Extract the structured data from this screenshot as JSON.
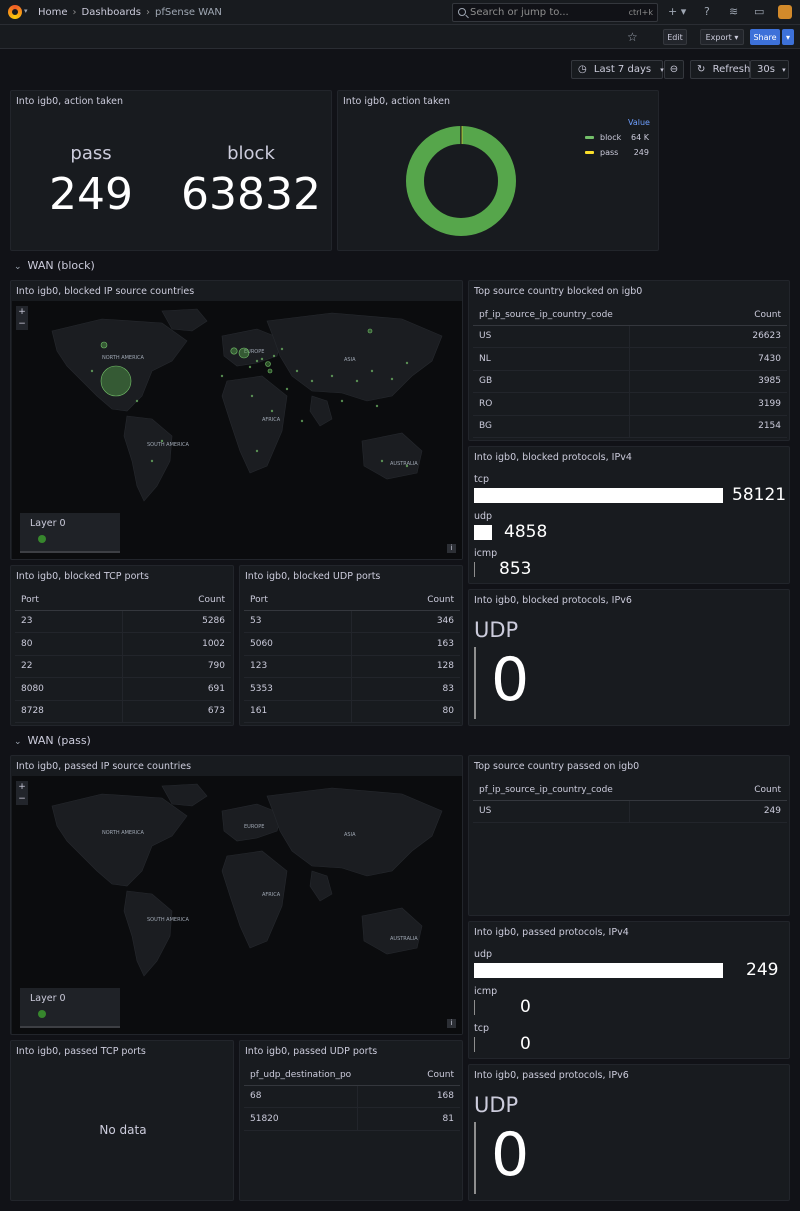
{
  "nav": {
    "breadcrumb": [
      "Home",
      "Dashboards",
      "pfSense WAN"
    ],
    "search_placeholder": "Search or jump to...",
    "search_shortcut": "ctrl+k",
    "icons": [
      "plus-icon",
      "help-icon",
      "rss-icon",
      "monitor-icon"
    ]
  },
  "toolbar": {
    "edit_label": "Edit",
    "export_label": "Export",
    "share_label": "Share"
  },
  "time": {
    "range_label": "Last 7 days",
    "refresh_label": "Refresh",
    "interval_label": "30s"
  },
  "colors": {
    "accent": "#3d71d9",
    "green": "#73bf69",
    "yellow": "#fade2a",
    "panel": "#181b1f",
    "background": "#111217"
  },
  "panels": {
    "action_stat": {
      "title": "Into igb0, action taken",
      "pass_label": "pass",
      "pass_value": "249",
      "block_label": "block",
      "block_value": "63832"
    },
    "action_pie": {
      "title": "Into igb0, action taken",
      "legend_header": "Value",
      "legend": [
        {
          "name": "block",
          "value": "64 K"
        },
        {
          "name": "pass",
          "value": "249"
        }
      ]
    },
    "row_block": {
      "title": "WAN (block)"
    },
    "blocked_map": {
      "title": "Into igb0, blocked IP source countries",
      "layer_label": "Layer 0",
      "info": "i"
    },
    "blocked_country": {
      "title": "Top source country blocked on igb0",
      "col1": "pf_ip_source_ip_country_code",
      "col2": "Count",
      "rows": [
        [
          "US",
          "26623"
        ],
        [
          "NL",
          "7430"
        ],
        [
          "GB",
          "3985"
        ],
        [
          "RO",
          "3199"
        ],
        [
          "BG",
          "2154"
        ]
      ]
    },
    "blocked_ipv4": {
      "title": "Into igb0, blocked protocols, IPv4",
      "items": [
        {
          "label": "tcp",
          "value": "58121"
        },
        {
          "label": "udp",
          "value": "4858"
        },
        {
          "label": "icmp",
          "value": "853"
        }
      ]
    },
    "blocked_tcp": {
      "title": "Into igb0, blocked TCP ports",
      "col1": "Port",
      "col2": "Count",
      "rows": [
        [
          "23",
          "5286"
        ],
        [
          "80",
          "1002"
        ],
        [
          "22",
          "790"
        ],
        [
          "8080",
          "691"
        ],
        [
          "8728",
          "673"
        ]
      ]
    },
    "blocked_udp": {
      "title": "Into igb0, blocked UDP ports",
      "col1": "Port",
      "col2": "Count",
      "rows": [
        [
          "53",
          "346"
        ],
        [
          "5060",
          "163"
        ],
        [
          "123",
          "128"
        ],
        [
          "5353",
          "83"
        ],
        [
          "161",
          "80"
        ]
      ]
    },
    "blocked_ipv6": {
      "title": "Into igb0, blocked protocols, IPv6",
      "label": "UDP",
      "value": "0"
    },
    "row_pass": {
      "title": "WAN (pass)"
    },
    "passed_map": {
      "title": "Into igb0, passed IP source countries",
      "layer_label": "Layer 0",
      "info": "i"
    },
    "passed_country": {
      "title": "Top source country passed on igb0",
      "col1": "pf_ip_source_ip_country_code",
      "col2": "Count",
      "rows": [
        [
          "US",
          "249"
        ]
      ]
    },
    "passed_ipv4": {
      "title": "Into igb0, passed protocols, IPv4",
      "items": [
        {
          "label": "udp",
          "value": "249"
        },
        {
          "label": "icmp",
          "value": "0"
        },
        {
          "label": "tcp",
          "value": "0"
        }
      ]
    },
    "passed_tcp": {
      "title": "Into igb0, passed TCP ports",
      "nodata": "No data"
    },
    "passed_udp": {
      "title": "Into igb0, passed UDP ports",
      "col1": "pf_udp_destination_po",
      "col2": "Count",
      "rows": [
        [
          "68",
          "168"
        ],
        [
          "51820",
          "81"
        ]
      ]
    },
    "passed_ipv6": {
      "title": "Into igb0, passed protocols, IPv6",
      "label": "UDP",
      "value": "0"
    }
  },
  "map_labels": [
    "NORTH AMERICA",
    "EUROPE",
    "ASIA",
    "AFRICA",
    "SOUTH AMERICA",
    "AUSTRALIA"
  ]
}
